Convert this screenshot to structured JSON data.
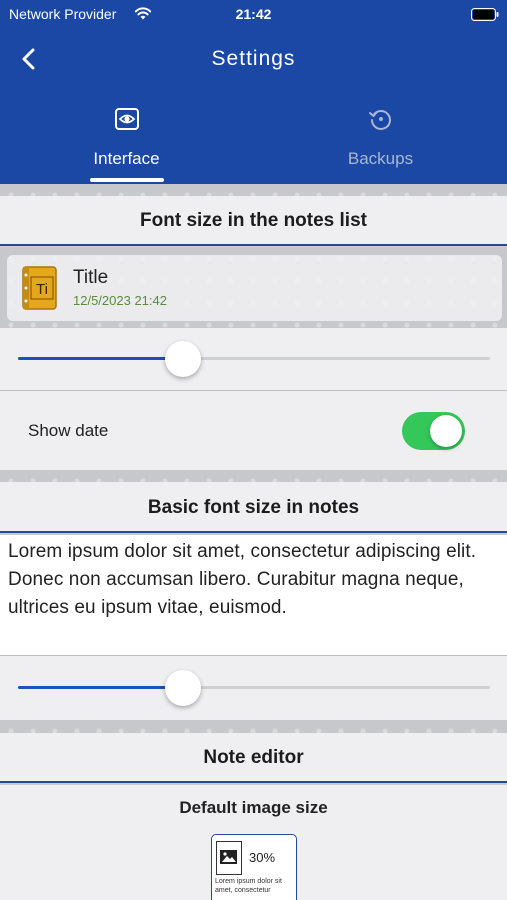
{
  "status_bar": {
    "carrier": "Network Provider",
    "time": "21:42",
    "wifi_icon": "wifi-icon",
    "battery_icon": "battery-full-icon"
  },
  "nav": {
    "title": "Settings",
    "back_icon": "chevron-left-icon"
  },
  "tabs": [
    {
      "label": "Interface",
      "icon": "eye-icon",
      "selected": true
    },
    {
      "label": "Backups",
      "icon": "history-icon",
      "selected": false
    }
  ],
  "notes_list": {
    "header": "Font size in the notes list",
    "preview": {
      "icon_text": "Ti",
      "title": "Title",
      "date": "12/5/2023 21:42"
    },
    "font_size_slider": 0.35
  },
  "show_date": {
    "label": "Show date",
    "enabled": true
  },
  "notes": {
    "header": "Basic font size in notes",
    "sample_text": "Lorem ipsum dolor sit amet, consectetur adipiscing elit. Donec non accumsan libero. Curabitur magna neque, ultrices eu ipsum vitae, euismod.",
    "font_size_slider": 0.35
  },
  "editor": {
    "header": "Note editor",
    "image_size_label": "Default image size",
    "image_size_value": "30%",
    "preview_text": "Lorem ipsum dolor sit amet, consectetur"
  },
  "colors": {
    "brand": "#1a48a4",
    "accent": "#1f4fbf",
    "toggle_on": "#34c759"
  }
}
